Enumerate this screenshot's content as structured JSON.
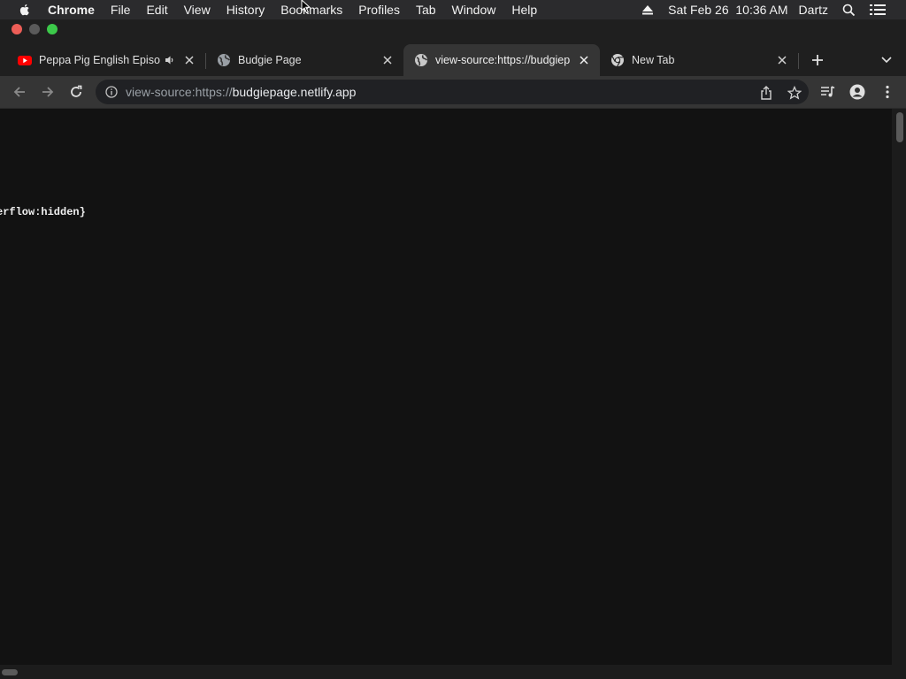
{
  "menubar": {
    "app_name": "Chrome",
    "items": [
      "File",
      "Edit",
      "View",
      "History",
      "Bookmarks",
      "Profiles",
      "Tab",
      "Window",
      "Help"
    ],
    "date_time": "Sat Feb 26  10:36 AM",
    "user": "Dartz"
  },
  "tabs": [
    {
      "title": "Peppa Pig English Episo",
      "favicon": "youtube-icon",
      "audio": true,
      "active": false
    },
    {
      "title": "Budgie Page",
      "favicon": "globe-icon",
      "active": false
    },
    {
      "title": "view-source:https://budgiep",
      "favicon": "globe-icon",
      "active": true
    },
    {
      "title": "New Tab",
      "favicon": "chrome-icon",
      "active": false
    }
  ],
  "toolbar": {
    "url_prefix": "view-source:https://",
    "url_host": "budgiepage.netlify.app"
  },
  "content": {
    "source_line": "erflow:hidden}"
  },
  "colors": {
    "menubar": "#2b2b2d",
    "tabstrip": "#1f1f1f",
    "toolbar": "#353535",
    "page_bg": "#121212",
    "traffic_close": "#ed5e57",
    "traffic_max": "#3cc94a"
  }
}
